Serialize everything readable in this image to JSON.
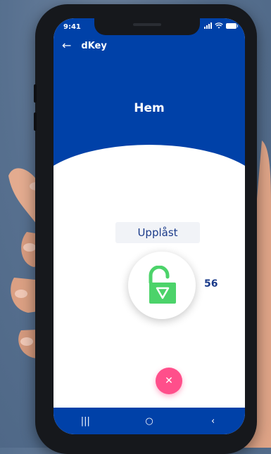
{
  "status_bar": {
    "time": "9:41"
  },
  "app_bar": {
    "title": "dKey"
  },
  "page": {
    "title": "Hem"
  },
  "lock": {
    "state_label": "Upplåst",
    "count": "56",
    "color": "#4cd36a"
  },
  "fab": {
    "icon": "close-icon"
  },
  "nav_bar": {
    "recents_icon": "|||",
    "home_icon": "○",
    "back_icon": "‹"
  },
  "colors": {
    "primary": "#0041a8",
    "accent": "#ff4f8b",
    "text_dark_blue": "#1b3b8a"
  }
}
